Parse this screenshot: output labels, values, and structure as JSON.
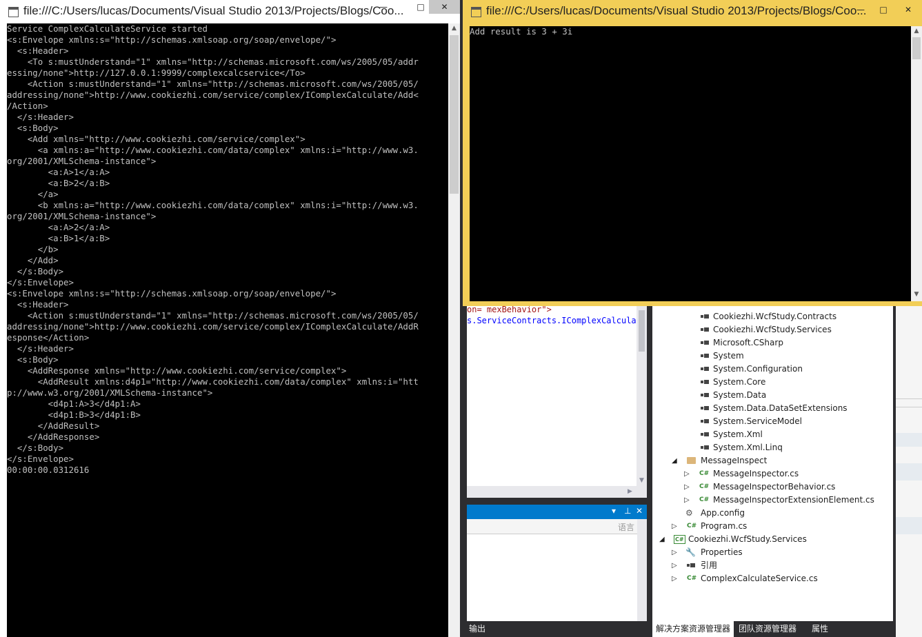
{
  "left_window": {
    "title": "file:///C:/Users/lucas/Documents/Visual Studio 2013/Projects/Blogs/Coo...",
    "controls": {
      "minimize": "—",
      "maximize": "□",
      "close": "✕"
    },
    "console_lines": [
      "Service ComplexCalculateService started",
      "<s:Envelope xmlns:s=\"http://schemas.xmlsoap.org/soap/envelope/\">",
      "  <s:Header>",
      "    <To s:mustUnderstand=\"1\" xmlns=\"http://schemas.microsoft.com/ws/2005/05/addr",
      "essing/none\">http://127.0.0.1:9999/complexcalcservice</To>",
      "    <Action s:mustUnderstand=\"1\" xmlns=\"http://schemas.microsoft.com/ws/2005/05/",
      "addressing/none\">http://www.cookiezhi.com/service/complex/IComplexCalculate/Add<",
      "/Action>",
      "  </s:Header>",
      "  <s:Body>",
      "    <Add xmlns=\"http://www.cookiezhi.com/service/complex\">",
      "      <a xmlns:a=\"http://www.cookiezhi.com/data/complex\" xmlns:i=\"http://www.w3.",
      "org/2001/XMLSchema-instance\">",
      "        <a:A>1</a:A>",
      "        <a:B>2</a:B>",
      "      </a>",
      "      <b xmlns:a=\"http://www.cookiezhi.com/data/complex\" xmlns:i=\"http://www.w3.",
      "org/2001/XMLSchema-instance\">",
      "        <a:A>2</a:A>",
      "        <a:B>1</a:B>",
      "      </b>",
      "    </Add>",
      "  </s:Body>",
      "</s:Envelope>",
      "<s:Envelope xmlns:s=\"http://schemas.xmlsoap.org/soap/envelope/\">",
      "  <s:Header>",
      "    <Action s:mustUnderstand=\"1\" xmlns=\"http://schemas.microsoft.com/ws/2005/05/",
      "addressing/none\">http://www.cookiezhi.com/service/complex/IComplexCalculate/AddR",
      "esponse</Action>",
      "  </s:Header>",
      "  <s:Body>",
      "    <AddResponse xmlns=\"http://www.cookiezhi.com/service/complex\">",
      "      <AddResult xmlns:d4p1=\"http://www.cookiezhi.com/data/complex\" xmlns:i=\"htt",
      "p://www.w3.org/2001/XMLSchema-instance\">",
      "        <d4p1:A>3</d4p1:A>",
      "        <d4p1:B>3</d4p1:B>",
      "      </AddResult>",
      "    </AddResponse>",
      "  </s:Body>",
      "</s:Envelope>",
      "00:00:00.0312616"
    ]
  },
  "right_window": {
    "title": "file:///C:/Users/lucas/Documents/Visual Studio 2013/Projects/Blogs/Coo...",
    "controls": {
      "minimize": "—",
      "maximize": "□",
      "close": "✕"
    },
    "console_lines": [
      "Add result is 3 + 3i"
    ]
  },
  "code_editor": {
    "lines": [
      {
        "text": "on= mexBehavior\">",
        "color": "#a31515"
      },
      {
        "text": "s.ServiceContracts.IComplexCalculat",
        "color": "#0000ff"
      }
    ]
  },
  "output_panel": {
    "tab_label": "输出",
    "lang_label": "语言",
    "controls": {
      "dropdown": "▾",
      "pin": "⊥",
      "close": "✕"
    }
  },
  "solution_explorer": {
    "items": [
      {
        "label": "Cookiezhi.WcfStudy.Contracts",
        "icon": "reference-icon"
      },
      {
        "label": "Cookiezhi.WcfStudy.Services",
        "icon": "reference-icon"
      },
      {
        "label": "Microsoft.CSharp",
        "icon": "reference-icon"
      },
      {
        "label": "System",
        "icon": "reference-icon"
      },
      {
        "label": "System.Configuration",
        "icon": "reference-icon"
      },
      {
        "label": "System.Core",
        "icon": "reference-icon"
      },
      {
        "label": "System.Data",
        "icon": "reference-icon"
      },
      {
        "label": "System.Data.DataSetExtensions",
        "icon": "reference-icon"
      },
      {
        "label": "System.ServiceModel",
        "icon": "reference-icon"
      },
      {
        "label": "System.Xml",
        "icon": "reference-icon"
      },
      {
        "label": "System.Xml.Linq",
        "icon": "reference-icon"
      },
      {
        "label": "MessageInspect",
        "icon": "folder-open-icon",
        "arrow": "◢"
      },
      {
        "label": "MessageInspector.cs",
        "icon": "csharp-file-icon",
        "arrow": "▷"
      },
      {
        "label": "MessageInspectorBehavior.cs",
        "icon": "csharp-file-icon",
        "arrow": "▷"
      },
      {
        "label": "MessageInspectorExtensionElement.cs",
        "icon": "csharp-file-icon",
        "arrow": "▷"
      },
      {
        "label": "App.config",
        "icon": "config-file-icon"
      },
      {
        "label": "Program.cs",
        "icon": "csharp-file-icon",
        "arrow": "▷"
      },
      {
        "label": "Cookiezhi.WcfStudy.Services",
        "icon": "csharp-project-icon",
        "arrow": "◢"
      },
      {
        "label": "Properties",
        "icon": "wrench-icon",
        "arrow": "▷"
      },
      {
        "label": "引用",
        "icon": "reference-icon",
        "arrow": "▷"
      },
      {
        "label": "ComplexCalculateService.cs",
        "icon": "csharp-file-icon",
        "arrow": "▷"
      }
    ],
    "tabs": [
      "解决方案资源管理器",
      "团队资源管理器",
      "属性"
    ]
  },
  "colors": {
    "console_bg": "#000000",
    "console_text": "#c0c0c0",
    "active_border": "#f2ce57",
    "vs_dark": "#2d2d30",
    "vs_blue": "#007acc"
  }
}
